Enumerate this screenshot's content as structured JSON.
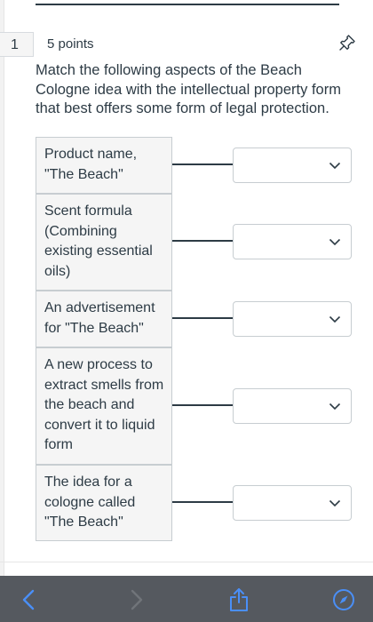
{
  "question": {
    "number": "1",
    "points": "5 points",
    "text": "Match the following aspects of the Beach Cologne idea with the intellectual property form that best offers some form of legal protection."
  },
  "matches": [
    {
      "prompt": "Product name, \"The Beach\"",
      "selected": ""
    },
    {
      "prompt": "Scent formula (Combining existing essential oils)",
      "selected": ""
    },
    {
      "prompt": "An advertisement for \"The Beach\"",
      "selected": ""
    },
    {
      "prompt": "A new process to extract smells from the beach and convert it to liquid form",
      "selected": ""
    },
    {
      "prompt": "The idea for a cologne called \"The Beach\"",
      "selected": ""
    }
  ],
  "icons": {
    "pin": "pin-icon",
    "dropdown": "chevron-down-icon",
    "back": "back-arrow-icon",
    "forward": "forward-arrow-icon",
    "share": "share-icon",
    "safari": "compass-icon"
  },
  "colors": {
    "text": "#2d3b45",
    "prompt_bg": "#f5f5f5",
    "border": "#c7cdd1",
    "toolbar_bg": "#55595f",
    "toolbar_accent": "#4a8ff7"
  }
}
